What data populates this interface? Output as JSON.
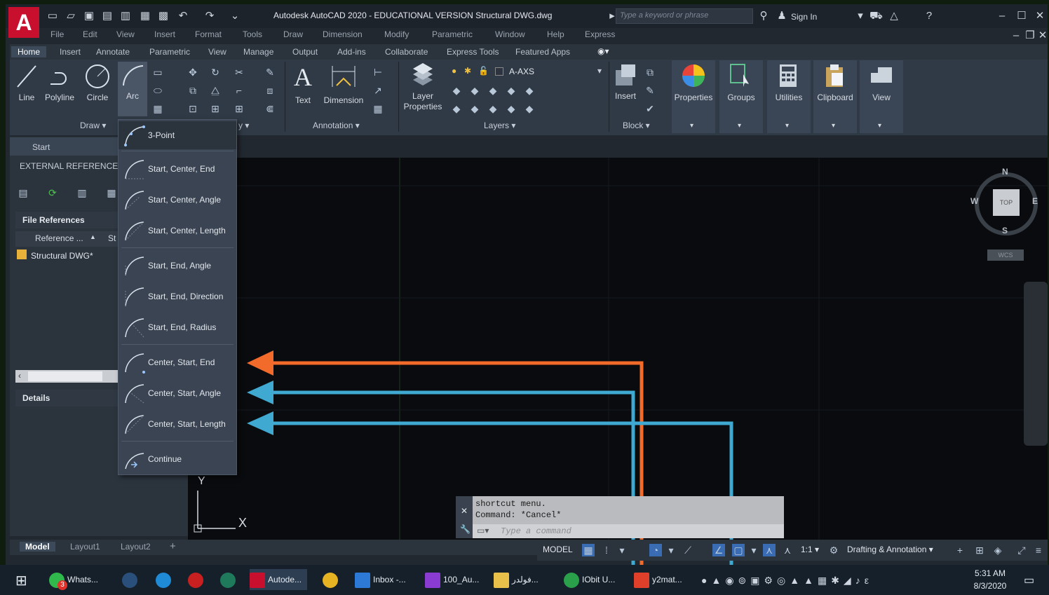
{
  "window": {
    "title": "Autodesk AutoCAD 2020 - EDUCATIONAL VERSION    Structural DWG.dwg",
    "search_placeholder": "Type a keyword or phrase",
    "sign_in": "Sign In",
    "logo_letter": "A"
  },
  "menu": [
    "File",
    "Edit",
    "View",
    "Insert",
    "Format",
    "Tools",
    "Draw",
    "Dimension",
    "Modify",
    "Parametric",
    "Window",
    "Help",
    "Express"
  ],
  "ribbon_tabs": [
    "Home",
    "Insert",
    "Annotate",
    "Parametric",
    "View",
    "Manage",
    "Output",
    "Add-ins",
    "Collaborate",
    "Express Tools",
    "Featured Apps"
  ],
  "ribbon": {
    "draw": {
      "line": "Line",
      "polyline": "Polyline",
      "circle": "Circle",
      "arc": "Arc",
      "panel": "Draw"
    },
    "annotation": {
      "text": "Text",
      "dimension": "Dimension",
      "panel": "Annotation"
    },
    "layers": {
      "layer_properties": "Layer Properties",
      "current_layer": "A-AXS",
      "panel": "Layers"
    },
    "block": {
      "insert": "Insert",
      "panel": "Block"
    },
    "tiles": [
      "Properties",
      "Groups",
      "Utilities",
      "Clipboard",
      "View"
    ]
  },
  "left_panel": {
    "start_tab": "Start",
    "title": "EXTERNAL REFERENCES",
    "file_references": "File References",
    "col_reference": "Reference ...",
    "col_status": "St",
    "row_name": "Structural DWG*",
    "details": "Details"
  },
  "arc_menu": {
    "items": [
      "3-Point",
      "Start, Center, End",
      "Start, Center, Angle",
      "Start, Center, Length",
      "Start, End, Angle",
      "Start, End, Direction",
      "Start, End, Radius",
      "Center, Start, End",
      "Center, Start, Angle",
      "Center, Start, Length",
      "Continue"
    ]
  },
  "viewcube": {
    "n": "N",
    "s": "S",
    "e": "E",
    "w": "W",
    "face": "TOP",
    "wcs": "WCS"
  },
  "ucs": {
    "y": "Y",
    "x": "X"
  },
  "command": {
    "history1": "shortcut menu.",
    "history2": "Command: *Cancel*",
    "placeholder": "Type a command"
  },
  "layout_tabs": [
    "Model",
    "Layout1",
    "Layout2",
    "+"
  ],
  "status": {
    "model": "MODEL",
    "scale": "1:1",
    "workspace": "Drafting & Annotation"
  },
  "taskbar": {
    "apps": [
      "Whats...",
      "Autode...",
      "Inbox -...",
      "100_Au...",
      "فولدر...",
      "IObit U...",
      "y2mat..."
    ],
    "badge": "3",
    "time": "5:31 AM",
    "date": "8/3/2020"
  },
  "colors": {
    "orange_arrow": "#f26b2a",
    "blue_arrow": "#3fa9d1",
    "logo": "#c8102e"
  }
}
